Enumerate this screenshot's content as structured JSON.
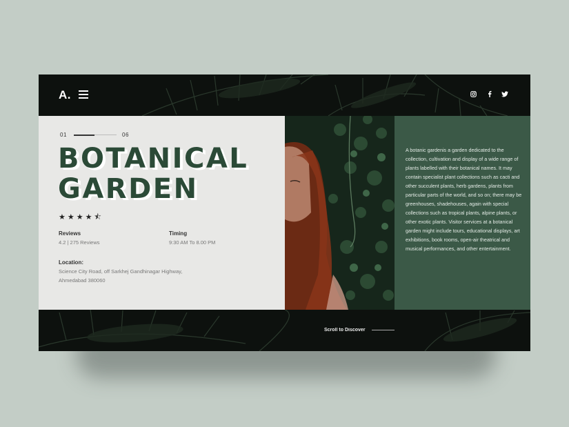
{
  "header": {
    "logo": "A.",
    "menu_icon": "hamburger-icon",
    "social_icons": [
      "instagram-icon",
      "facebook-icon",
      "twitter-icon"
    ]
  },
  "slider": {
    "current": "01",
    "total": "06"
  },
  "title_line1": "BOTANICAL",
  "title_line2": "GARDEN",
  "rating": {
    "stars": "★★★★⯪",
    "value": 4.5
  },
  "reviews": {
    "label": "Reviews",
    "value": "4.2 | 275 Reviews"
  },
  "timing": {
    "label": "Timing",
    "value": "9:30 AM To 8.00 PM"
  },
  "location": {
    "label": "Location:",
    "line1": "Science City Road, off Sarkhej Gandhinagar Highway,",
    "line2": "Ahmedabad 380060"
  },
  "description": "A botanic gardenis a garden dedicated to the collection, cultivation and display of a wide range of plants labelled with their botanical names. It may contain specialist plant collections such as cacti and other succulent plants, herb gardens, plants from particular parts of the world, and so on; there may be greenhouses, shadehouses, again with special collections such as tropical plants, alpine plants, or other exotic plants. Visitor services at a botanical garden might include tours, educational displays, art exhibitions, book rooms, open-air theatrical and musical performances, and other entertainment.",
  "scroll_label": "Scroll to Discover",
  "colors": {
    "page_bg": "#c3cdc6",
    "dark_bg": "#0d110e",
    "title_green": "#2b4a37",
    "panel_green": "#3b5947",
    "panel_light": "#e8e8e6"
  }
}
